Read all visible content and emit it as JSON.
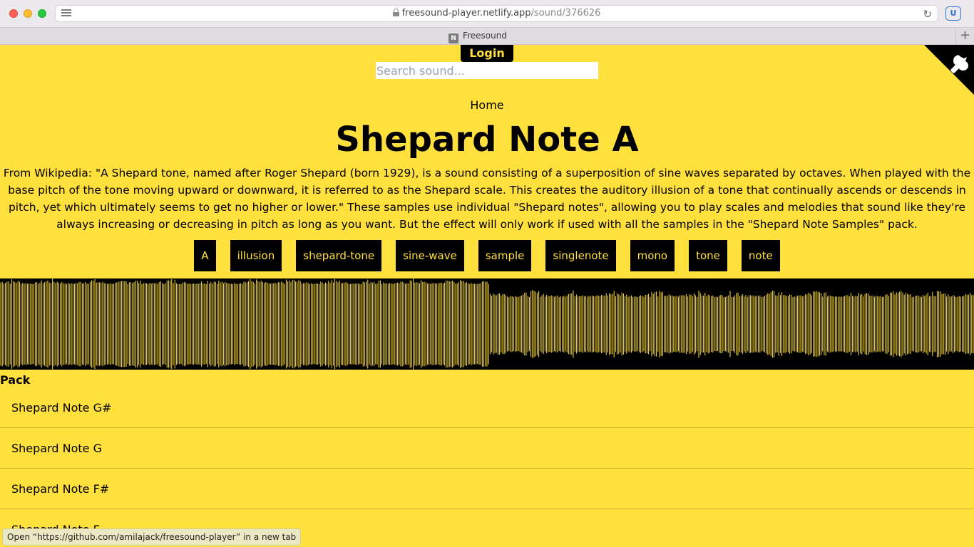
{
  "browser": {
    "url_host": "freesound-player.netlify.app",
    "url_path": "/sound/376626",
    "tab_title": "Freesound",
    "tab_favicon": "N",
    "shield_label": "U"
  },
  "header": {
    "login_label": "Login",
    "search_placeholder": "Search sound...",
    "home_label": "Home"
  },
  "sound": {
    "title": "Shepard Note A",
    "description": "From Wikipedia:   \"A Shepard tone, named after Roger Shepard (born 1929), is a sound consisting of a superposition of sine waves separated by octaves. When played with the base pitch of the tone moving upward or downward, it is referred to as the Shepard scale. This creates the auditory illusion of a tone that continually ascends or descends in pitch, yet which ultimately seems to get no higher or lower.\"   These samples use individual \"Shepard notes\", allowing you to play scales and melodies that sound like they're always increasing or decreasing in pitch as long as you want. But the effect will only work if used with all the samples in the \"Shepard Note Samples\" pack.",
    "tags": [
      "A",
      "illusion",
      "shepard-tone",
      "sine-wave",
      "sample",
      "singlenote",
      "mono",
      "tone",
      "note"
    ]
  },
  "pack": {
    "label": "Pack",
    "items": [
      "Shepard Note G#",
      "Shepard Note G",
      "Shepard Note F#",
      "Shepard Note F"
    ]
  },
  "status_bar": {
    "text": "Open “https://github.com/amilajack/freesound-player” in a new tab"
  },
  "colors": {
    "background": "#ffe03c",
    "accent": "#000000",
    "waveform": "#ffe03c"
  },
  "icons": [
    "reader-icon",
    "lock-icon",
    "reload-icon",
    "shield-icon",
    "github-corner-icon",
    "new-tab-icon"
  ]
}
